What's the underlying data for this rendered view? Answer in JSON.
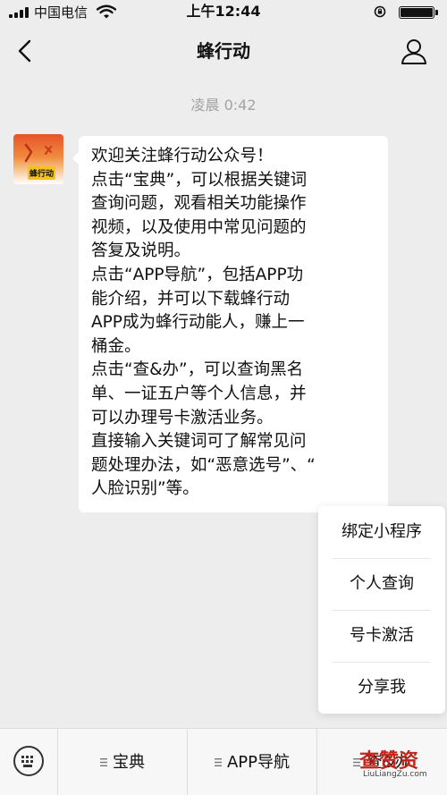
{
  "status_bar": {
    "carrier": "中国电信",
    "time": "上午12:44"
  },
  "header": {
    "title": "蜂行动"
  },
  "chat": {
    "timestamp": "凌晨 0:42",
    "message_lines": [
      "欢迎关注蜂行动公众号！",
      "点击“宝典”，可以根据关键词",
      "查询问题，观看相关功能操作",
      "视频，以及使用中常见问题的",
      "答复及说明。",
      "点击“APP导航”，包括APP功",
      "能介绍，并可以下载蜂行动",
      "APP成为蜂行动能人，赚上一",
      "桶金。",
      "点击“查&办”，可以查询黑名",
      "单、一证五户等个人信息，并",
      "可以办理号卡激活业务。",
      "直接输入关键词可了解常见问",
      "题处理办法，如“恶意选号”、“",
      "人脸识别”等。"
    ]
  },
  "popup_menu": {
    "items": [
      "绑定小程序",
      "个人查询",
      "号卡激活",
      "分享我"
    ]
  },
  "bottom_menu": {
    "tabs": [
      "宝典",
      "APP导航",
      "查&办"
    ]
  },
  "watermark": {
    "text": "查赞资",
    "url": "LiuLiangZu.com"
  },
  "colors": {
    "background": "#ededed",
    "bubble": "#ffffff",
    "timestamp": "#a3a3a3",
    "watermark": "#c0261c"
  }
}
